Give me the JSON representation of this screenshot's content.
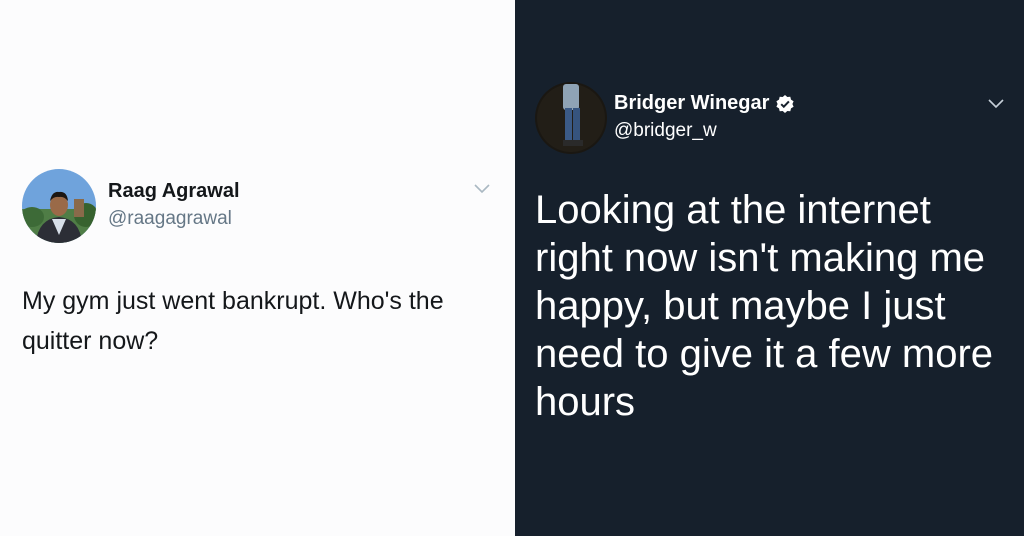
{
  "left_tweet": {
    "name": "Raag Agrawal",
    "handle": "@raagagrawal",
    "text": "My gym just went bankrupt. Who's the quitter now?",
    "avatar_icon": "profile-photo",
    "menu_icon": "chevron-down-icon"
  },
  "right_tweet": {
    "name": "Bridger Winegar",
    "verified": true,
    "handle": "@bridger_w",
    "text": "Looking at the internet right now isn't making me happy, but maybe I just need to give it a few more hours",
    "avatar_icon": "profile-photo",
    "menu_icon": "chevron-down-icon"
  },
  "colors": {
    "light_bg": "#fcfcfd",
    "dark_bg": "#16202c",
    "muted_text": "#657786"
  }
}
